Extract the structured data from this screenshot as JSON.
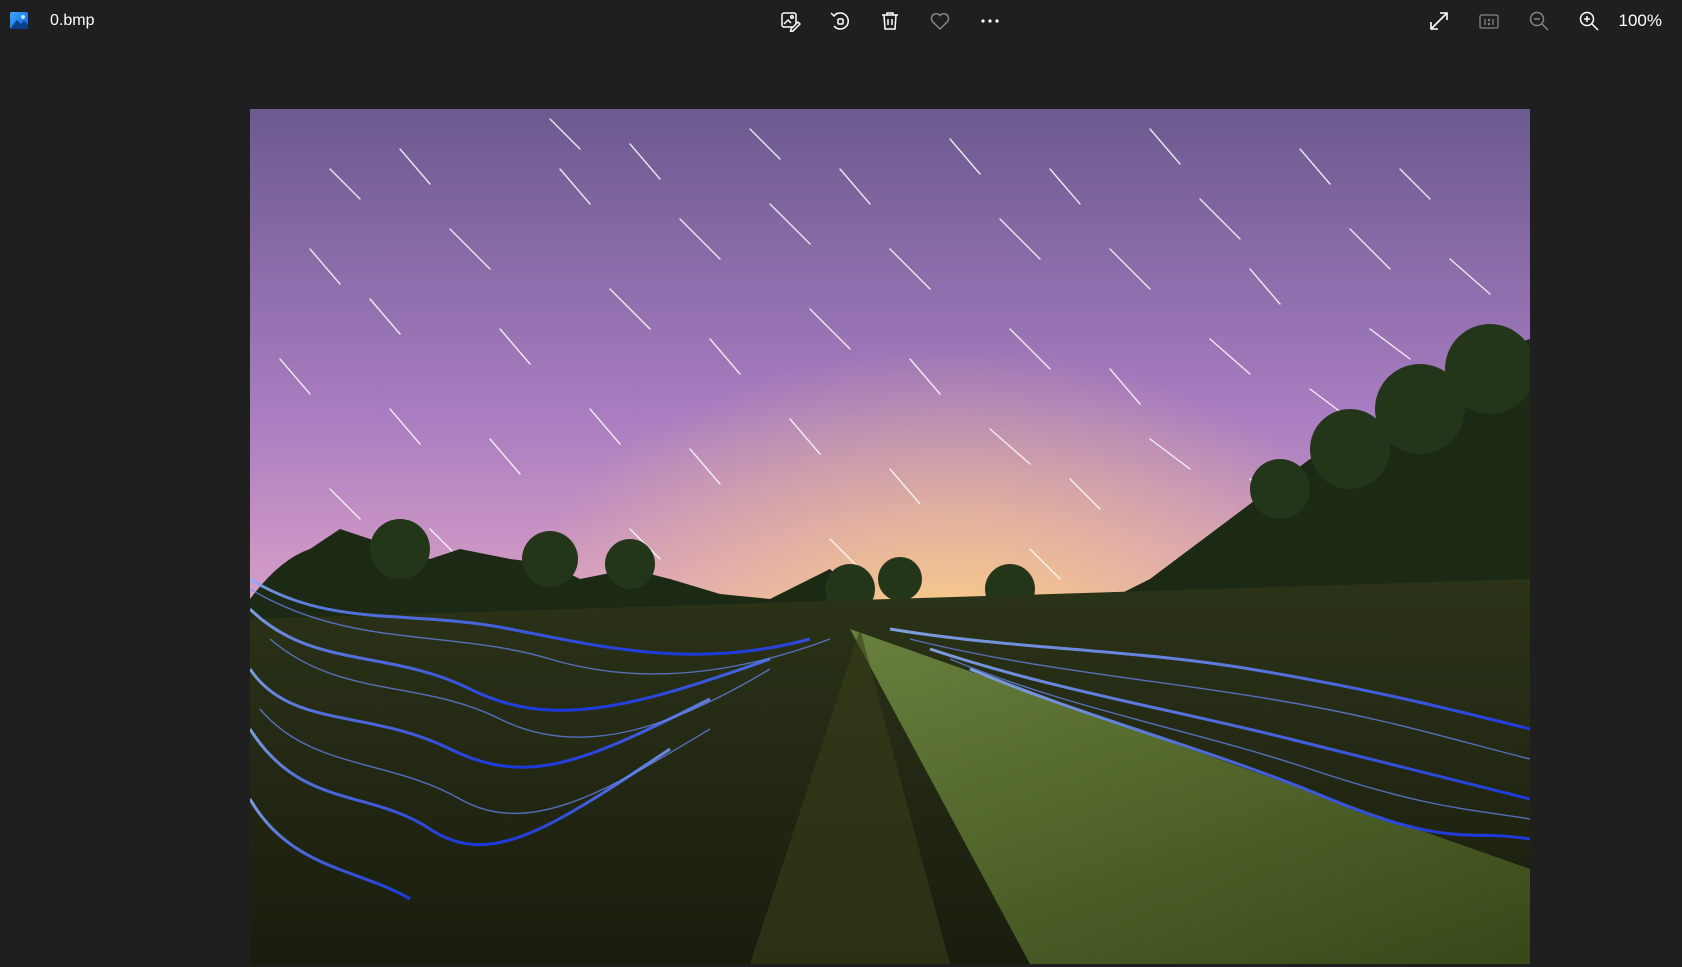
{
  "window": {
    "file_name": "0.bmp"
  },
  "toolbar": {
    "center_buttons": [
      {
        "name": "edit-image-button",
        "icon": "edit-image-icon"
      },
      {
        "name": "rotate-button",
        "icon": "rotate-icon"
      },
      {
        "name": "delete-button",
        "icon": "trash-icon"
      },
      {
        "name": "favorite-button",
        "icon": "heart-icon"
      },
      {
        "name": "more-options-button",
        "icon": "more-icon"
      }
    ],
    "right_buttons": [
      {
        "name": "full-screen-button",
        "icon": "expand-icon"
      },
      {
        "name": "actual-size-button",
        "icon": "actual-size-icon",
        "label": "1:1"
      },
      {
        "name": "zoom-out-button",
        "icon": "zoom-out-icon"
      },
      {
        "name": "zoom-in-button",
        "icon": "zoom-in-icon"
      }
    ],
    "zoom_level": "100%"
  },
  "image": {
    "description_icon": "photo-light-painting",
    "colors": {
      "sky_top": "#6d5a8e",
      "sky_mid": "#b27fc0",
      "horizon": "#f5b25a",
      "trees": "#1d2b14",
      "grass": "#4a5a22",
      "light_trails": "#2f5bff"
    }
  }
}
